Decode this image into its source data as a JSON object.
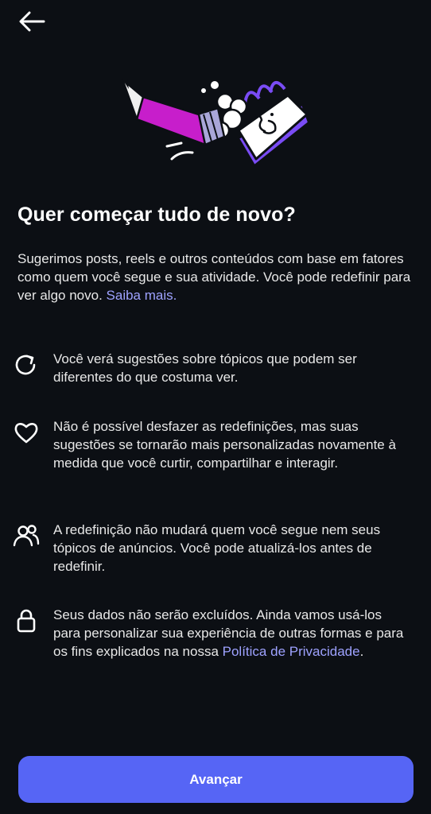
{
  "header": {
    "back_icon": "arrow-left-icon"
  },
  "illustration": {
    "name": "pencil-and-notebook-illustration",
    "colors": {
      "magenta": "#c71ecb",
      "purple": "#7a4cf5",
      "white": "#ffffff"
    }
  },
  "title": "Quer começar tudo de novo?",
  "intro": {
    "text": "Sugerimos posts, reels e outros conteúdos com base em fatores como quem você segue e sua atividade. Você pode redefinir para ver algo novo.",
    "link": "Saiba mais."
  },
  "items": [
    {
      "icon": "refresh-icon",
      "text": "Você verá sugestões sobre tópicos que podem ser diferentes do que costuma ver."
    },
    {
      "icon": "heart-icon",
      "text": "Não é possível desfazer as redefinições, mas suas sugestões se tornarão mais personalizadas novamente à medida que você curtir, compartilhar e interagir."
    },
    {
      "icon": "people-icon",
      "text": "A redefinição não mudará quem você segue nem seus tópicos de anúncios. Você pode atualizá-los antes de redefinir."
    },
    {
      "icon": "lock-icon",
      "text": "Seus dados não serão excluídos. Ainda vamos usá-los para personalizar sua experiência de outras formas e para os fins explicados na nossa",
      "link": "Política de Privacidade",
      "suffix": "."
    }
  ],
  "cta": {
    "label": "Avançar"
  },
  "colors": {
    "background": "#0c0f14",
    "accent": "#5665f5",
    "link": "#9ea2ff"
  }
}
